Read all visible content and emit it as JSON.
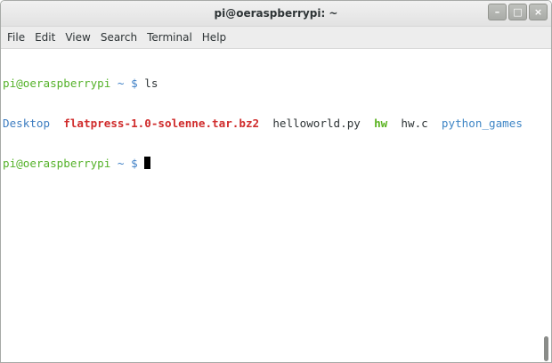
{
  "window": {
    "title": "pi@oeraspberrypi: ~",
    "buttons": {
      "minimize": "–",
      "maximize": "□",
      "close": "×"
    }
  },
  "menu": [
    "File",
    "Edit",
    "View",
    "Search",
    "Terminal",
    "Help"
  ],
  "terminal": {
    "prompt_user": "pi@oeraspberrypi",
    "prompt_rest": " ~ $",
    "command": "ls",
    "listing": [
      {
        "name": "Desktop",
        "kind": "directory"
      },
      {
        "name": "flatpress-1.0-solenne.tar.bz2",
        "kind": "archive"
      },
      {
        "name": "helloworld.py",
        "kind": "file"
      },
      {
        "name": "hw",
        "kind": "executable"
      },
      {
        "name": "hw.c",
        "kind": "file"
      },
      {
        "name": "python_games",
        "kind": "directory"
      }
    ]
  },
  "colors": {
    "prompt_user": "#55b22a",
    "directory": "#3f7ec1",
    "archive": "#d02c2c",
    "executable": "#5ab320"
  }
}
